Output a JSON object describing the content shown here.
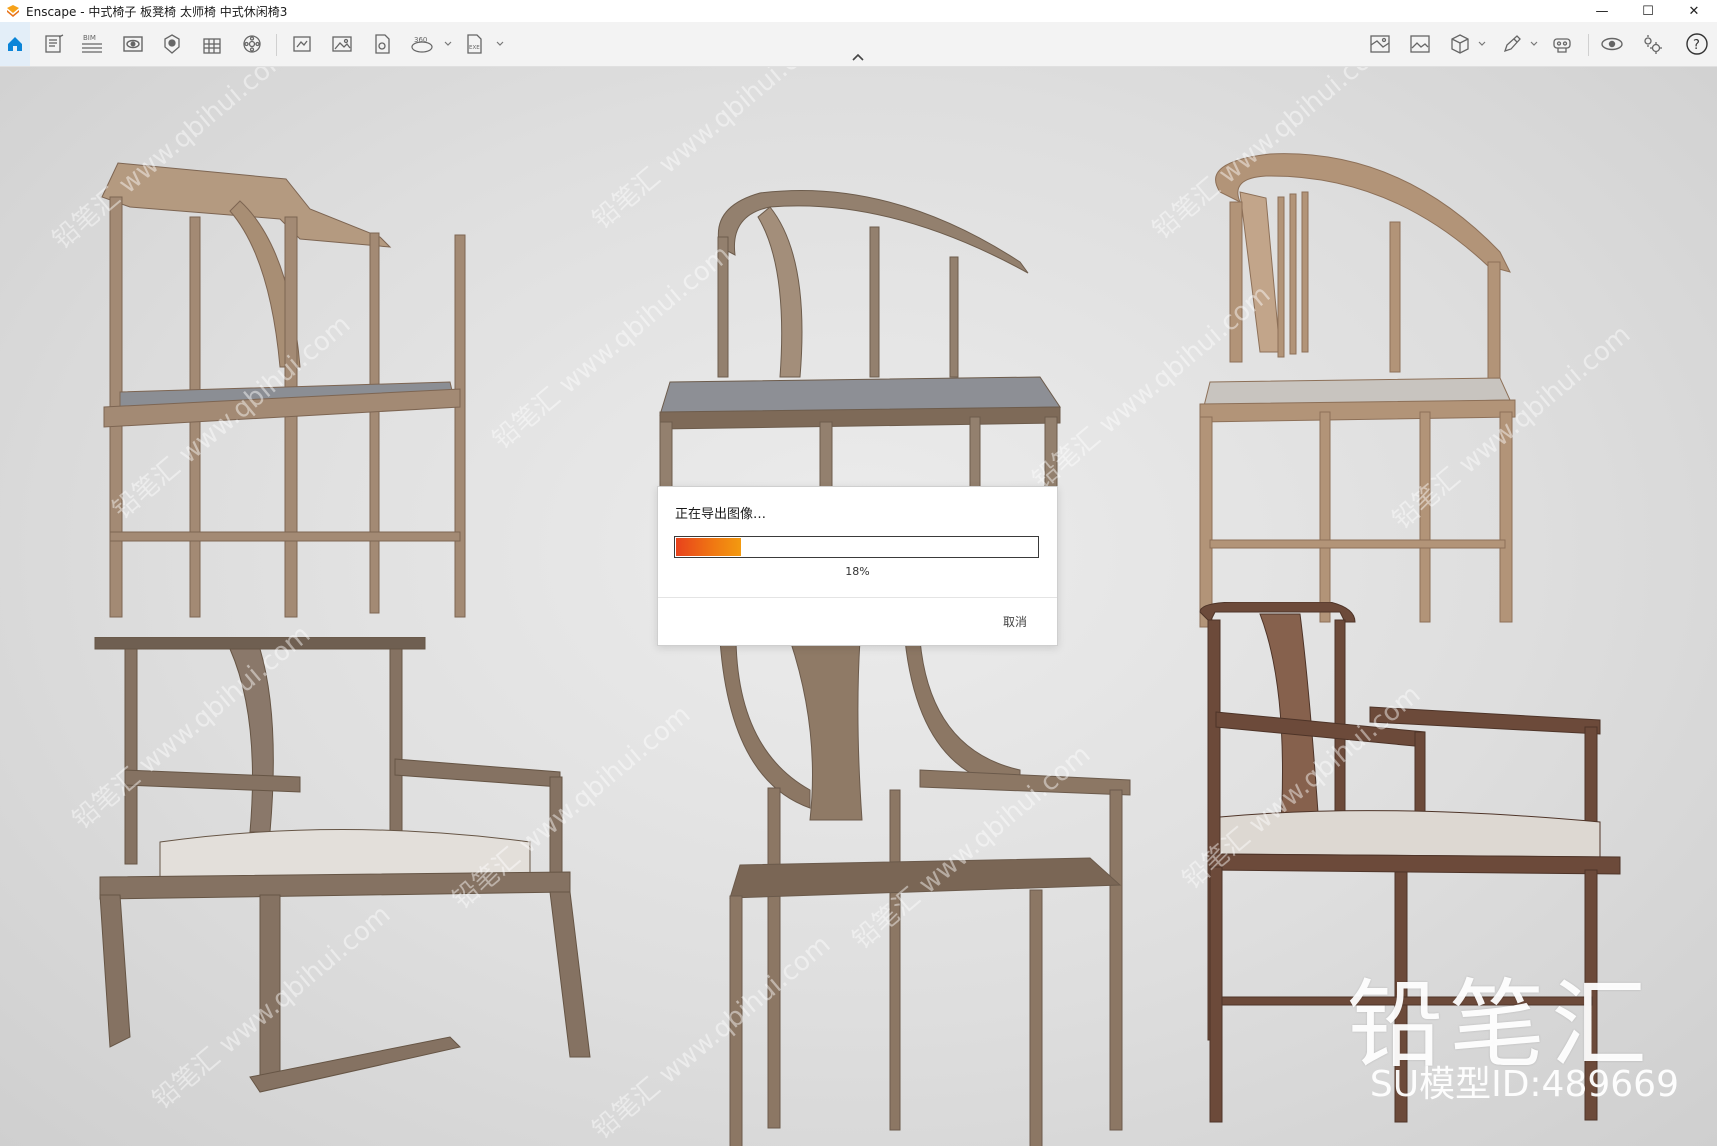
{
  "window": {
    "title": "Enscape - 中式椅子 板凳椅 太师椅 中式休闲椅3",
    "minimize": "—",
    "maximize": "☐",
    "close": "✕"
  },
  "toolbar": {
    "left_icons": [
      "home-icon",
      "document-icon",
      "bim-icon",
      "eye-icon",
      "sun-icon",
      "building-icon",
      "asset-library-icon",
      "frame-icon",
      "image-icon",
      "batch-render-icon",
      "panorama-360-icon",
      "exe-export-icon"
    ],
    "right_icons": [
      "map-icon",
      "photo-icon",
      "cube-icon",
      "pen-icon",
      "vr-icon",
      "view-settings-icon",
      "settings-icon",
      "help-icon"
    ],
    "bim_label": "BIM",
    "pano_label": "360",
    "exe_label": "EXE",
    "help_label": "?",
    "accent": "#0078d7"
  },
  "dialog": {
    "title": "正在导出图像…",
    "progress": 0.18,
    "progress_label": "18%",
    "cancel": "取消",
    "progress_colors": [
      "#e8421c",
      "#f39a10"
    ]
  },
  "watermark": {
    "logo": "铅笔汇",
    "model_id": "SU模型ID:489669",
    "repeat_text": "铅笔汇  www.qbihui.com"
  }
}
